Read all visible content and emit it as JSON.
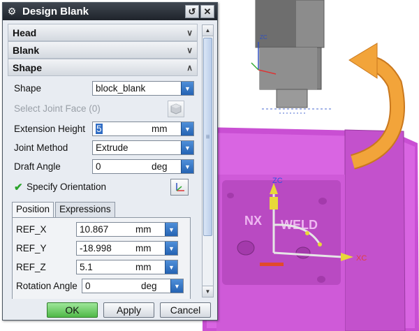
{
  "dialog": {
    "title": "Design Blank",
    "groups": {
      "head": "Head",
      "blank": "Blank",
      "shape": "Shape"
    },
    "shape": {
      "shape_label": "Shape",
      "shape_value": "block_blank",
      "select_joint_face_label": "Select Joint Face (0)",
      "extension_height_label": "Extension Height",
      "extension_height_value": "5",
      "extension_height_unit": "mm",
      "joint_method_label": "Joint Method",
      "joint_method_value": "Extrude",
      "draft_angle_label": "Draft Angle",
      "draft_angle_value": "0",
      "draft_angle_unit": "deg",
      "specify_orientation_label": "Specify Orientation"
    },
    "tabs": [
      "Position",
      "Expressions"
    ],
    "position": {
      "ref_x_label": "REF_X",
      "ref_x_value": "10.867",
      "ref_x_unit": "mm",
      "ref_y_label": "REF_Y",
      "ref_y_value": "-18.998",
      "ref_y_unit": "mm",
      "ref_z_label": "REF_Z",
      "ref_z_value": "5.1",
      "ref_z_unit": "mm",
      "rotation_label": "Rotation Angle",
      "rotation_value": "0",
      "rotation_unit": "deg"
    },
    "buttons": {
      "ok": "OK",
      "apply": "Apply",
      "cancel": "Cancel"
    }
  },
  "viewport": {
    "axis_labels": {
      "zc": "ZC",
      "xc": "XC",
      "yc": "Y"
    },
    "part_text": "NX",
    "part_text_2": "WELD",
    "colors": {
      "part": "#d75be0",
      "arrow": "#f0a030",
      "punch": "#7d7d7d"
    }
  }
}
